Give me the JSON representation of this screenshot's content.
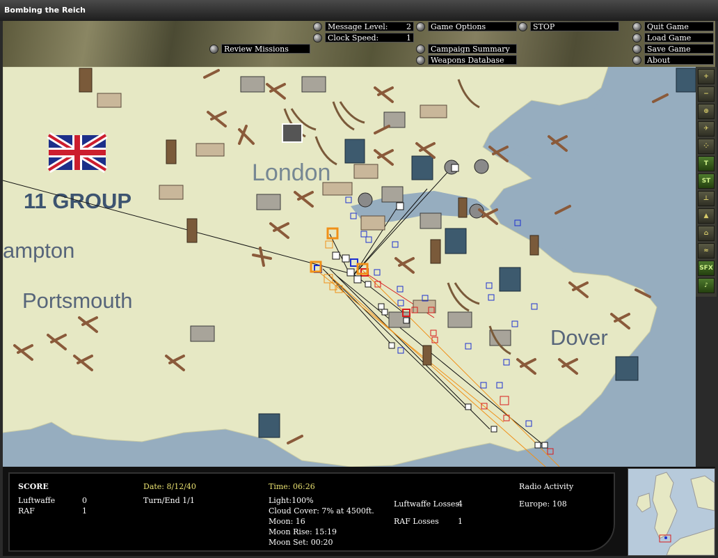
{
  "window": {
    "title": "Bombing the Reich"
  },
  "controls": {
    "message_level_label": "Message Level:",
    "message_level_value": "2",
    "clock_speed_label": "Clock Speed:",
    "clock_speed_value": "1",
    "review_missions": "Review Missions",
    "game_options": "Game Options",
    "campaign_summary": "Campaign Summary",
    "weapons_database": "Weapons Database",
    "stop": "STOP",
    "quit_game": "Quit Game",
    "load_game": "Load Game",
    "save_game": "Save Game",
    "about": "About"
  },
  "map": {
    "labels": {
      "london": "London",
      "group": "11 GROUP",
      "hampton": "ampton",
      "portsmouth": "Portsmouth",
      "dover": "Dover"
    },
    "colors": {
      "land": "#e6e8c4",
      "sea": "#96adbf",
      "enemy": "#1c2fd0",
      "raf": "#d81c1c",
      "track": "#f09018"
    }
  },
  "toolbar": {
    "tools": [
      {
        "name": "zoom-in-icon",
        "glyph": "+"
      },
      {
        "name": "zoom-out-icon",
        "glyph": "−"
      },
      {
        "name": "center-icon",
        "glyph": "⊕"
      },
      {
        "name": "aircraft-icon",
        "glyph": "✈"
      },
      {
        "name": "formation-icon",
        "glyph": "⁘"
      },
      {
        "name": "target-icon",
        "glyph": "T"
      },
      {
        "name": "st-icon",
        "glyph": "ST"
      },
      {
        "name": "airfield-icon",
        "glyph": "⊥"
      },
      {
        "name": "flak-icon",
        "glyph": "▲"
      },
      {
        "name": "factory-icon",
        "glyph": "⌂"
      },
      {
        "name": "ship-icon",
        "glyph": "≈"
      },
      {
        "name": "sfx-icon",
        "glyph": "SFX"
      },
      {
        "name": "music-icon",
        "glyph": "♪"
      }
    ]
  },
  "status": {
    "score_title": "SCORE",
    "luftwaffe_label": "Luftwaffe",
    "luftwaffe_score": "0",
    "raf_label": "RAF",
    "raf_score": "1",
    "date": "Date: 8/12/40",
    "turn": "Turn/End 1/1",
    "time": "Time: 06:26",
    "light": "Light:100%",
    "cloud_cover": "Cloud Cover: 7% at 4500ft.",
    "moon": "Moon: 16",
    "moon_rise": "Moon Rise: 15:19",
    "moon_set": "Moon Set: 00:20",
    "luftwaffe_losses_label": "Luftwaffe Losses",
    "luftwaffe_losses": "4",
    "raf_losses_label": "RAF Losses",
    "raf_losses": "1",
    "radio_title": "Radio Activity",
    "radio_europe": "Europe: 108"
  }
}
